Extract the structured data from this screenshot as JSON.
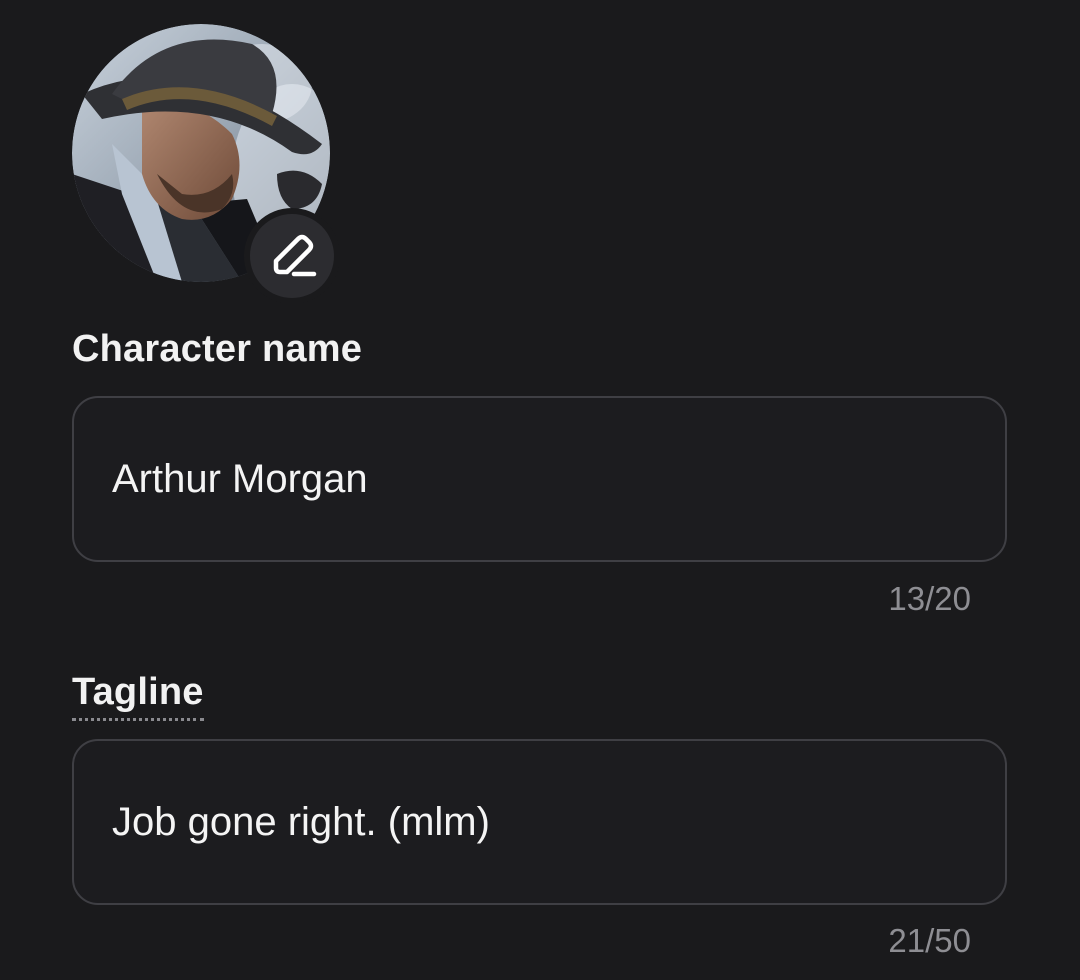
{
  "profile": {
    "avatar_alt": "Character avatar",
    "edit_icon": "pencil-icon"
  },
  "fields": {
    "name": {
      "label": "Character name",
      "value": "Arthur Morgan",
      "counter": "13/20"
    },
    "tagline": {
      "label": "Tagline",
      "value": "Job gone right. (mlm)",
      "counter": "21/50"
    }
  },
  "colors": {
    "background": "#1a1a1c",
    "input_border": "#3f3f44",
    "text": "#f4f4f4",
    "muted": "#8e8e93",
    "edit_button": "#2c2c30"
  }
}
